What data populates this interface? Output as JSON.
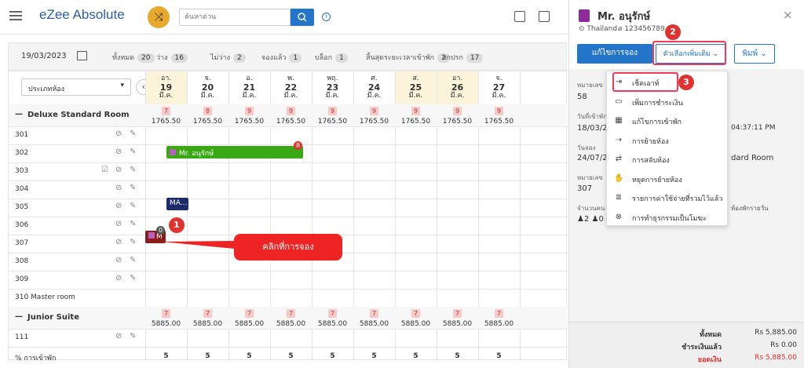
{
  "topbar": {
    "app_name": "eZee Absolute",
    "search_placeholder": "ค้นหาด่วน",
    "info_icon": "i"
  },
  "filter": {
    "date": "19/03/2023",
    "stats": [
      {
        "label": "ทั้งหมด",
        "count": "20"
      },
      {
        "label": "ว่าง",
        "count": "16"
      },
      {
        "label": "ไม่ว่าง",
        "count": "2"
      },
      {
        "label": "จองแล้ว",
        "count": "1"
      },
      {
        "label": "บล็อก",
        "count": "1"
      },
      {
        "label": "สิ้นสุดระยะเวลาเข้าพัก",
        "count": "2"
      },
      {
        "label": "สกปรก",
        "count": "17"
      }
    ]
  },
  "grid": {
    "room_type_select": "ประเภทห้อง",
    "prev_arrow": "‹",
    "days": [
      {
        "dow": "อา.",
        "num": "19",
        "mon": "มี.ค.",
        "weekend": true
      },
      {
        "dow": "จ.",
        "num": "20",
        "mon": "มี.ค.",
        "weekend": false
      },
      {
        "dow": "อ.",
        "num": "21",
        "mon": "มี.ค.",
        "weekend": false
      },
      {
        "dow": "พ.",
        "num": "22",
        "mon": "มี.ค.",
        "weekend": false
      },
      {
        "dow": "พฤ.",
        "num": "23",
        "mon": "มี.ค.",
        "weekend": false
      },
      {
        "dow": "ศ.",
        "num": "24",
        "mon": "มี.ค.",
        "weekend": false
      },
      {
        "dow": "ส.",
        "num": "25",
        "mon": "มี.ค.",
        "weekend": true
      },
      {
        "dow": "อา.",
        "num": "26",
        "mon": "มี.ค.",
        "weekend": true
      },
      {
        "dow": "จ.",
        "num": "27",
        "mon": "มี.ค.",
        "weekend": false
      }
    ],
    "sections": [
      {
        "name": "Deluxe Standard Room",
        "avail": [
          "7",
          "8",
          "9",
          "9",
          "9",
          "9",
          "9",
          "9",
          "9"
        ],
        "price": [
          "1765.50",
          "1765.50",
          "1765.50",
          "1765.50",
          "1765.50",
          "1765.50",
          "1765.50",
          "1765.50",
          "1765.50"
        ],
        "rooms": [
          "301",
          "302",
          "303",
          "304",
          "305",
          "306",
          "307",
          "308",
          "309",
          "310 Master room"
        ]
      },
      {
        "name": "Junior Suite",
        "avail": [
          "7",
          "7",
          "7",
          "7",
          "7",
          "7",
          "7",
          "7",
          "7"
        ],
        "price": [
          "5885.00",
          "5885.00",
          "5885.00",
          "5885.00",
          "5885.00",
          "5885.00",
          "5885.00",
          "5885.00",
          "5885.00"
        ],
        "rooms": [
          "111"
        ]
      }
    ],
    "reservations": {
      "res302": "Mr. อนุรักษ์",
      "res302_badge": "8",
      "res305": "MA...",
      "res307": "M",
      "res307_badge": "0"
    },
    "occupancy_label": "% การเข้าพัก",
    "occupancy": [
      "5",
      "5",
      "5",
      "5",
      "5",
      "5",
      "5",
      "5",
      "5"
    ]
  },
  "callout": {
    "step1": "1",
    "text": "คลิกที่การจอง"
  },
  "panel": {
    "guest_name": "Mr. อนุรักษ์",
    "country": "Thailand",
    "phone": "123456789",
    "close": "×",
    "edit_btn": "แก้ไขการจอง",
    "more_btn": "ตัวเลือกเพิ่มเติม",
    "print_btn": "พิมพ์",
    "step2": "2",
    "step3": "3",
    "fields": {
      "res_no_label": "หมายเลข",
      "res_no_value": "58",
      "arrival_label": "วันที่เข้าพัก",
      "arrival_value": "18/03/20",
      "arrival_time": "04:37:11 PM",
      "booking_label": "วันจอง",
      "booking_value": "24/07/20",
      "room_type_value": "dard Room",
      "room_label": "หมายเลข",
      "room_value": "307",
      "guests_label": "จำนวนคน",
      "rate_label": "ห้องพักรายวัน",
      "adults": "2",
      "children": "0"
    },
    "menu": [
      {
        "label": "เช็คเอาท์",
        "icon": "checkout-icon",
        "glyph": "⇥"
      },
      {
        "label": "เพิ่มการชำระเงิน",
        "icon": "payment-icon",
        "glyph": "▭"
      },
      {
        "label": "แก้ไขการเข้าพัก",
        "icon": "calendar-edit-icon",
        "glyph": "▦"
      },
      {
        "label": "การย้ายห้อง",
        "icon": "move-room-icon",
        "glyph": "⇢"
      },
      {
        "label": "การสลับห้อง",
        "icon": "swap-room-icon",
        "glyph": "⇄"
      },
      {
        "label": "หยุดการย้ายห้อง",
        "icon": "hand-stop-icon",
        "glyph": "✋"
      },
      {
        "label": "รายการค่าใช้จ่ายที่รวมไว้แล้ว",
        "icon": "inclusion-list-icon",
        "glyph": "≣"
      },
      {
        "label": "การทำธุรกรรมเป็นโมฆะ",
        "icon": "void-icon",
        "glyph": "⊗"
      }
    ],
    "footer": {
      "total_label": "ทั้งหมด",
      "total_value": "Rs 5,885.00",
      "paid_label": "ชำระเงินแล้ว",
      "paid_value": "Rs 0.00",
      "balance_label": "ยอดเงิน",
      "balance_value": "Rs 5,885.00"
    }
  },
  "colors": {
    "accent": "#2275c8",
    "reservation_green": "#3aa814",
    "reservation_navy": "#1d2a6b",
    "reservation_maroon": "#8b1d1d",
    "highlight": "#ee3a5b",
    "callout": "#ee2424"
  }
}
